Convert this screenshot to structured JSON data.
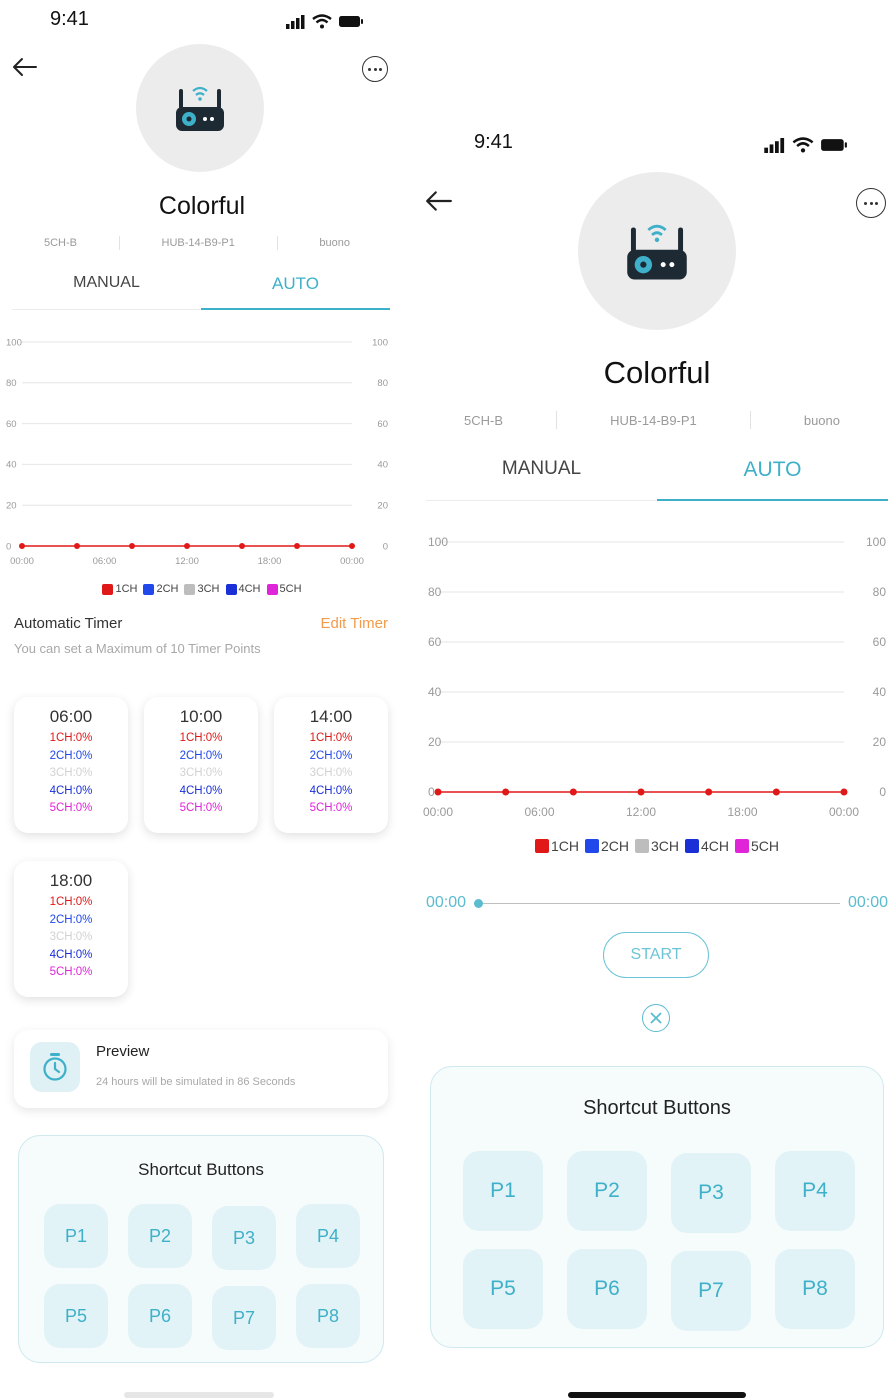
{
  "colors": {
    "accent": "#3eb0c9",
    "edit": "#f29b4a",
    "ch1": "#e01818",
    "ch2": "#2048ea",
    "ch3": "#bdbdbd",
    "ch4": "#1a2fd6",
    "ch5": "#e024d8"
  },
  "left": {
    "status": {
      "time": "9:41",
      "icons": [
        "signal-icon",
        "wifi-icon",
        "battery-icon"
      ]
    },
    "device": {
      "name": "Colorful",
      "model": "5CH-B",
      "hub": "HUB-14-B9-P1",
      "status": "buono"
    },
    "tabs": [
      {
        "label": "MANUAL",
        "active": false
      },
      {
        "label": "AUTO",
        "active": true
      }
    ],
    "timer": {
      "title": "Automatic Timer",
      "edit": "Edit Timer",
      "note": "You can set a Maximum of 10 Timer Points",
      "cards": [
        {
          "time": "06:00",
          "ch1": "1CH:0%",
          "ch2": "2CH:0%",
          "ch3": "3CH:0%",
          "ch4": "4CH:0%",
          "ch5": "5CH:0%"
        },
        {
          "time": "10:00",
          "ch1": "1CH:0%",
          "ch2": "2CH:0%",
          "ch3": "3CH:0%",
          "ch4": "4CH:0%",
          "ch5": "5CH:0%"
        },
        {
          "time": "14:00",
          "ch1": "1CH:0%",
          "ch2": "2CH:0%",
          "ch3": "3CH:0%",
          "ch4": "4CH:0%",
          "ch5": "5CH:0%"
        },
        {
          "time": "18:00",
          "ch1": "1CH:0%",
          "ch2": "2CH:0%",
          "ch3": "3CH:0%",
          "ch4": "4CH:0%",
          "ch5": "5CH:0%"
        }
      ]
    },
    "preview": {
      "title": "Preview",
      "note": "24 hours will be simulated in 86 Seconds"
    },
    "shortcuts": {
      "title": "Shortcut Buttons",
      "buttons": [
        "P1",
        "P2",
        "P3",
        "P4",
        "P5",
        "P6",
        "P7",
        "P8"
      ]
    }
  },
  "right": {
    "status": {
      "time": "9:41",
      "icons": [
        "signal-icon",
        "wifi-icon",
        "battery-icon"
      ]
    },
    "device": {
      "name": "Colorful",
      "model": "5CH-B",
      "hub": "HUB-14-B9-P1",
      "status": "buono"
    },
    "tabs": [
      {
        "label": "MANUAL",
        "active": false
      },
      {
        "label": "AUTO",
        "active": true
      }
    ],
    "playback": {
      "start_time": "00:00",
      "end_time": "00:00",
      "progress": 0,
      "start_label": "START"
    },
    "shortcuts": {
      "title": "Shortcut Buttons",
      "buttons": [
        "P1",
        "P2",
        "P3",
        "P4",
        "P5",
        "P6",
        "P7",
        "P8"
      ]
    }
  },
  "chart_data": [
    {
      "type": "line",
      "x": [
        "00:00",
        "04:00",
        "08:00",
        "12:00",
        "16:00",
        "20:00",
        "24:00"
      ],
      "x_ticks": [
        "00:00",
        "06:00",
        "12:00",
        "18:00",
        "00:00"
      ],
      "y_ticks": [
        0,
        20,
        40,
        60,
        80,
        100
      ],
      "ylim": [
        0,
        100
      ],
      "grid": true,
      "legend_position": "bottom",
      "series": [
        {
          "name": "1CH",
          "values": [
            0,
            0,
            0,
            0,
            0,
            0,
            0
          ]
        }
      ],
      "legend": [
        "1CH",
        "2CH",
        "3CH",
        "4CH",
        "5CH"
      ]
    },
    {
      "type": "line",
      "x": [
        "00:00",
        "04:00",
        "08:00",
        "12:00",
        "16:00",
        "20:00",
        "24:00"
      ],
      "x_ticks": [
        "00:00",
        "06:00",
        "12:00",
        "18:00",
        "00:00"
      ],
      "y_ticks": [
        0,
        20,
        40,
        60,
        80,
        100
      ],
      "ylim": [
        0,
        100
      ],
      "grid": true,
      "legend_position": "bottom",
      "series": [
        {
          "name": "1CH",
          "values": [
            0,
            0,
            0,
            0,
            0,
            0,
            0
          ]
        }
      ],
      "legend": [
        "1CH",
        "2CH",
        "3CH",
        "4CH",
        "5CH"
      ]
    }
  ]
}
